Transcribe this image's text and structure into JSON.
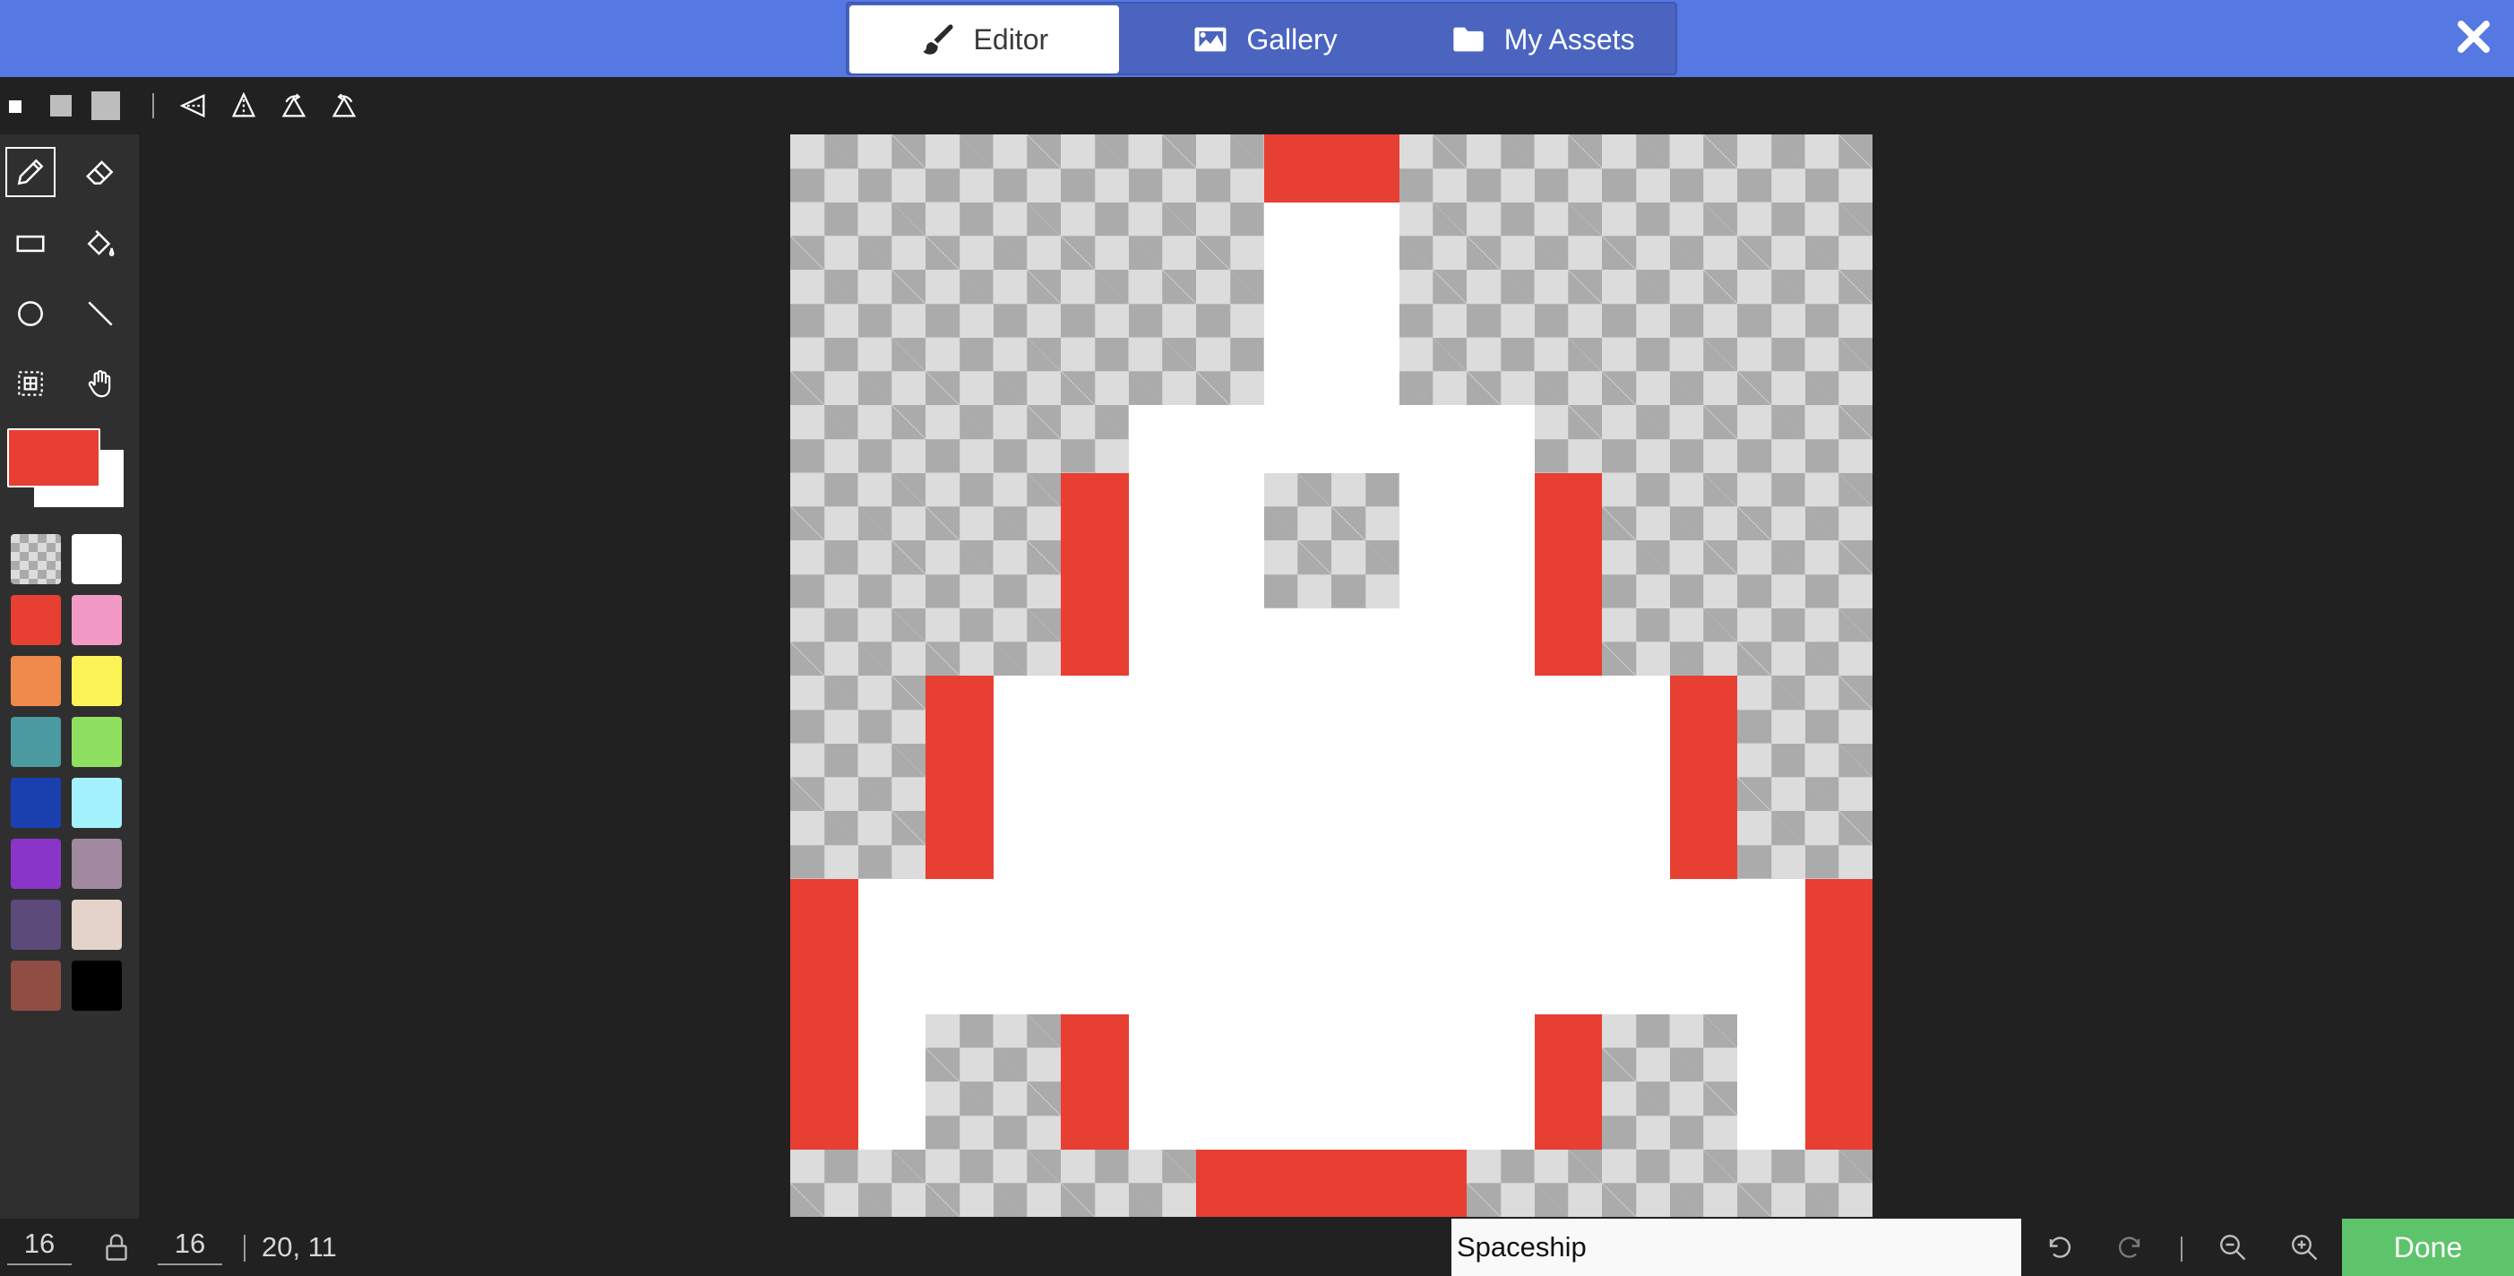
{
  "header": {
    "tabs": [
      {
        "label": "Editor",
        "icon": "paintbrush-icon",
        "active": true
      },
      {
        "label": "Gallery",
        "icon": "image-icon",
        "active": false
      },
      {
        "label": "My Assets",
        "icon": "folder-icon",
        "active": false
      }
    ],
    "close_icon": "close-icon"
  },
  "toolbar": {
    "brush_sizes": [
      "small",
      "medium",
      "large"
    ],
    "transforms": [
      "flip-horizontal-icon",
      "flip-vertical-icon",
      "rotate-counterclockwise-icon",
      "rotate-clockwise-icon"
    ]
  },
  "tools": {
    "items": [
      "pencil-icon",
      "eraser-icon",
      "rectangle-icon",
      "fill-bucket-icon",
      "circle-icon",
      "line-icon",
      "marquee-icon",
      "hand-icon"
    ],
    "selected": "pencil-icon"
  },
  "colors": {
    "primary": "#e83f33",
    "secondary": "#ffffff",
    "palette": [
      "transparent",
      "#ffffff",
      "#e83f33",
      "#f29ac5",
      "#f08a4c",
      "#fcf457",
      "#4a9aa0",
      "#8fe060",
      "#1a40b0",
      "#a3f1fd",
      "#8a35c9",
      "#a18aa0",
      "#5c4a7a",
      "#e3d3ca",
      "#8f4d44",
      "#000000"
    ]
  },
  "canvas": {
    "width": 16,
    "height": 16,
    "rows": [
      "tttttttRRttttttt",
      "tttttttWWttttttt",
      "tttttttWWttttttt",
      "tttttttWWttttttt",
      "tttttWWWWWWttttt",
      "ttttRWWttWWRtttt",
      "ttttRWWttWWRtttt",
      "ttttRWWWWWWRtttt",
      "ttRWWWWWWWWWWRtt",
      "ttRWWWWWWWWWWRtt",
      "ttRWWWWWWWWWWRtt",
      "RWWWWWWWWWWWWWWR",
      "RWWWWWWWWWWWWWWR",
      "RWttRWWWWWWRttWR",
      "RWttRWWWWWWRttWR",
      "ttttttRRRRtttttt"
    ]
  },
  "bottom": {
    "width_value": "16",
    "height_value": "16",
    "coords": "20, 11",
    "filename": "Spaceship",
    "done_label": "Done"
  }
}
